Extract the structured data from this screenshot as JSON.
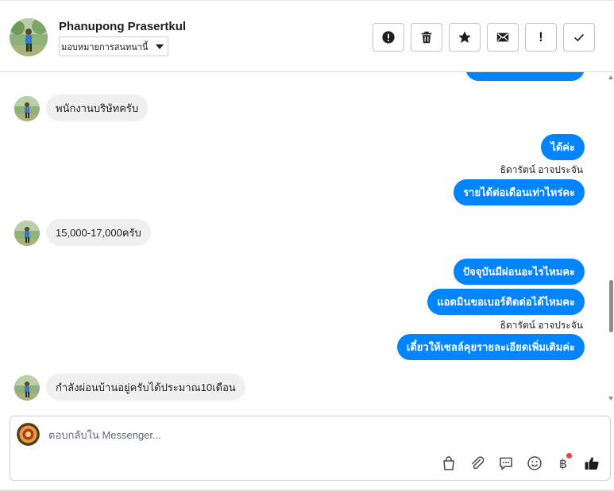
{
  "header": {
    "contact_name": "Phanupong Prasertkul",
    "assign_label": "มอบหมายการสนทนานี้",
    "toolbar": [
      {
        "name": "report-spam-button",
        "icon": "alert-circle-icon"
      },
      {
        "name": "delete-button",
        "icon": "trash-icon"
      },
      {
        "name": "star-button",
        "icon": "star-icon"
      },
      {
        "name": "mark-unread-button",
        "icon": "envelope-icon"
      },
      {
        "name": "follow-up-button",
        "icon": "exclamation-icon",
        "glyph": "!"
      },
      {
        "name": "mark-done-button",
        "icon": "checkmark-icon"
      }
    ]
  },
  "messages": [
    {
      "direction": "outgoing",
      "text": "",
      "partial": true
    },
    {
      "direction": "incoming",
      "text": "พนักงานบริษัทครับ"
    },
    {
      "direction": "outgoing",
      "text": "ได้ค่ะ"
    },
    {
      "direction": "sender",
      "text": "ธิดารัตน์ อาจประจัน"
    },
    {
      "direction": "outgoing",
      "text": "รายได้ต่อเดือนเท่าไหร่คะ"
    },
    {
      "direction": "incoming",
      "text": "15,000-17,000ครับ"
    },
    {
      "direction": "outgoing",
      "text": "ปัจจุบันมีผ่อนอะไรไหมคะ"
    },
    {
      "direction": "outgoing",
      "text": "แอดมินขอเบอร์ติดต่อได้ไหมคะ"
    },
    {
      "direction": "sender",
      "text": "ธิดารัตน์ อาจประจัน"
    },
    {
      "direction": "outgoing",
      "text": "เดี๋ยวให้เซลล์คุยรายละเอียดเพิ่มเติมค่ะ"
    },
    {
      "direction": "incoming",
      "text": "กำลังผ่อนบ้านอยู่ครับได้ประมาณ10เดือน"
    }
  ],
  "composer": {
    "placeholder": "ตอบกลับใน Messenger...",
    "tools": [
      "shopping-bag-icon",
      "paperclip-icon",
      "saved-replies-icon",
      "emoji-icon",
      "payment-icon",
      "like-icon"
    ],
    "payment_glyph": "฿"
  },
  "colors": {
    "outgoing_bubble": "#0084ff",
    "incoming_bubble": "#f0f0f0",
    "notification_dot": "#fa3e3e"
  }
}
